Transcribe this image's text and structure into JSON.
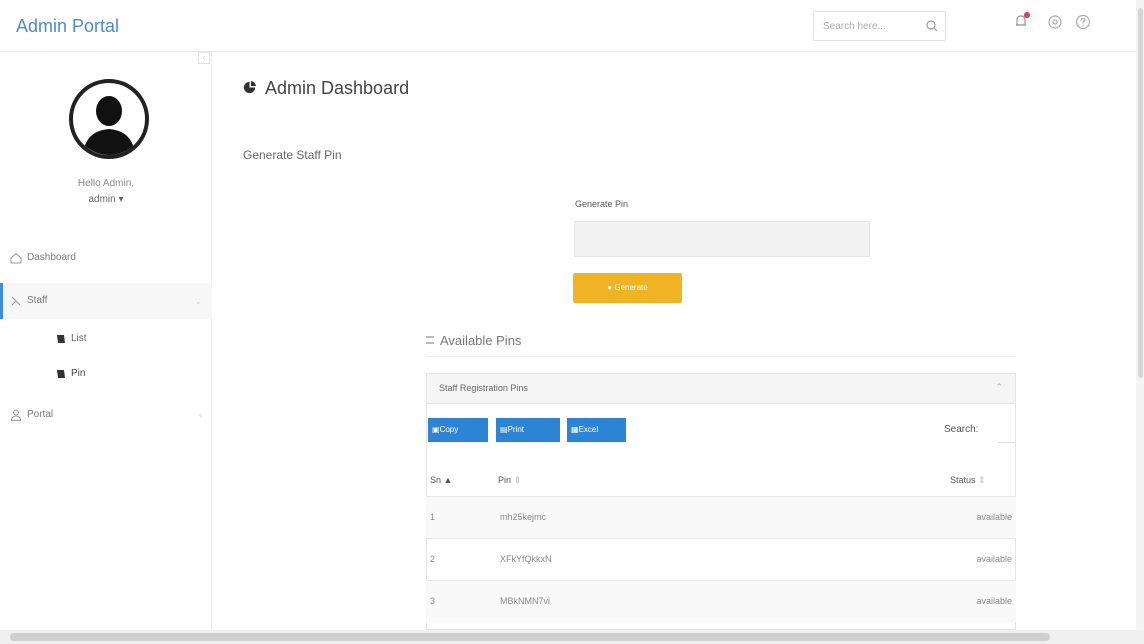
{
  "header": {
    "brand": "Admin Portal",
    "search_placeholder": "Search here..."
  },
  "sidebar": {
    "greeting": "Hello Admin,",
    "username": "admin ▾",
    "items": [
      {
        "label": "Dashboard"
      },
      {
        "label": "Staff",
        "active": true,
        "subitems": [
          {
            "label": "List"
          },
          {
            "label": "Pin"
          }
        ]
      },
      {
        "label": "Portal"
      }
    ]
  },
  "main": {
    "title": "Admin Dashboard",
    "section": "Generate Staff Pin",
    "form": {
      "label": "Generate Pin",
      "button": "Generate"
    },
    "available_pins": {
      "title": "Available Pins",
      "panel_title": "Staff Registration Pins",
      "buttons": [
        "Copy",
        "Print",
        "Excel"
      ],
      "search_label": "Search:",
      "columns": [
        "Sn",
        "Pin",
        "Status"
      ],
      "rows": [
        {
          "sn": "1",
          "pin": "mh25kejmc",
          "status": "available"
        },
        {
          "sn": "2",
          "pin": "XFkYfQkkxN",
          "status": "available"
        },
        {
          "sn": "3",
          "pin": "MBkNMN7vi",
          "status": "available"
        }
      ]
    }
  },
  "colors": {
    "accent": "#2e84d4",
    "generate_button": "#f0b323",
    "brand": "#4b8bd6"
  }
}
